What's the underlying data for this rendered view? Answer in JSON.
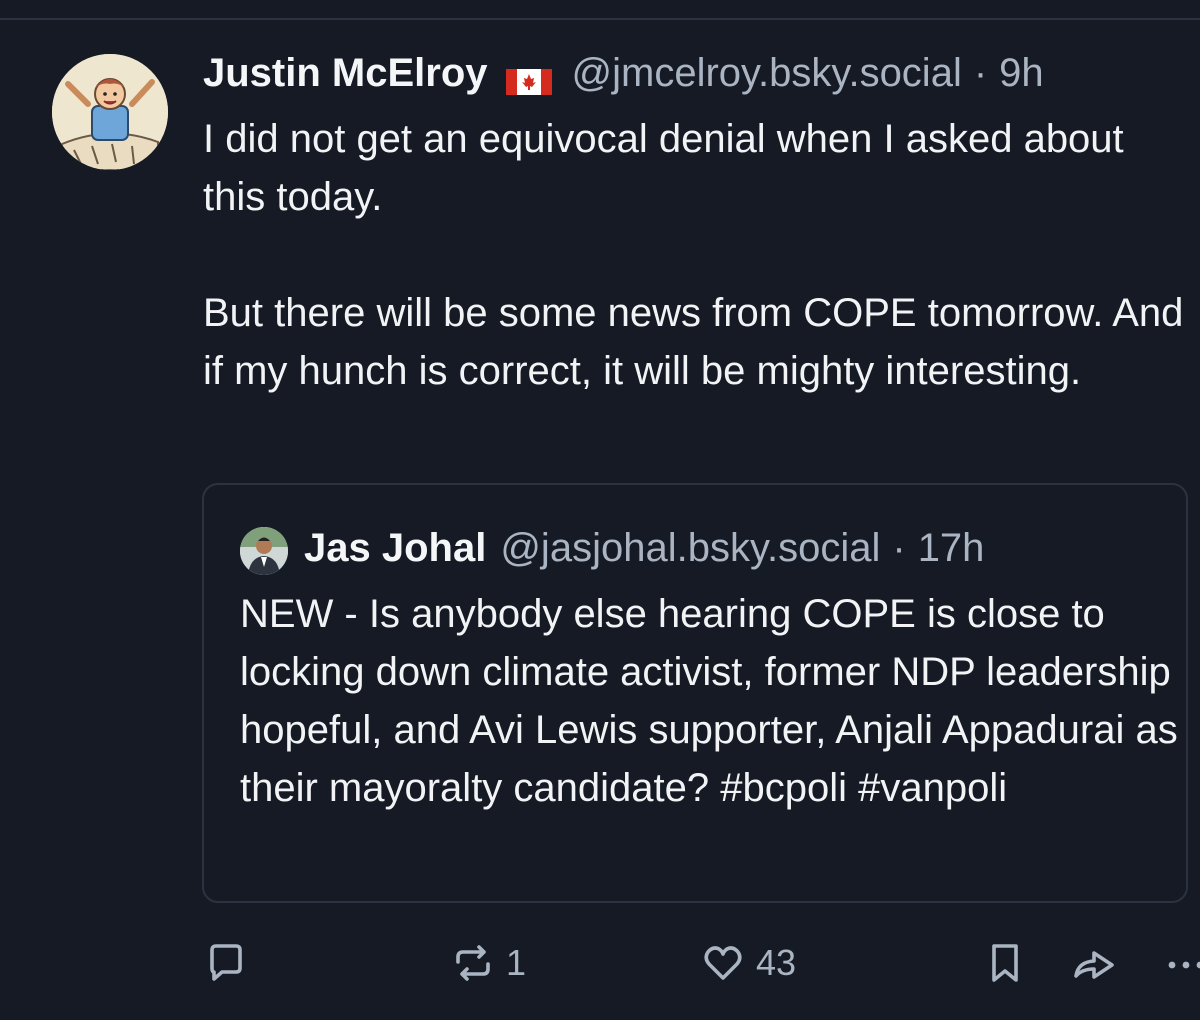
{
  "post": {
    "author_name": "Justin McElroy",
    "flag_icon": "canada-flag-icon",
    "handle": "@jmcelroy.bsky.social",
    "separator": "·",
    "time": "9h",
    "paragraphs": [
      "I did not get an equivocal denial when I asked about this today.",
      "But there will be some news from COPE tomorrow. And if my hunch is correct, it will be mighty interesting."
    ]
  },
  "quote": {
    "author_name": "Jas Johal",
    "handle": "@jasjohal.bsky.social",
    "separator": "·",
    "time": "17h",
    "text": "NEW - Is anybody else hearing COPE is close to locking down climate activist, former NDP leadership hopeful, and Avi Lewis supporter, Anjali Appadurai as their mayoralty candidate? #bcpoli #vanpoli"
  },
  "actions": {
    "reply_icon": "reply-icon",
    "repost_icon": "repost-icon",
    "repost_count": "1",
    "like_icon": "heart-icon",
    "like_count": "43",
    "bookmark_icon": "bookmark-icon",
    "share_icon": "share-icon",
    "more_icon": "more-icon"
  },
  "colors": {
    "background": "#151a24",
    "text": "#f1f3f5",
    "muted": "#aab4c2",
    "card_border": "#2b3342",
    "flag_red": "#d52b1e"
  }
}
